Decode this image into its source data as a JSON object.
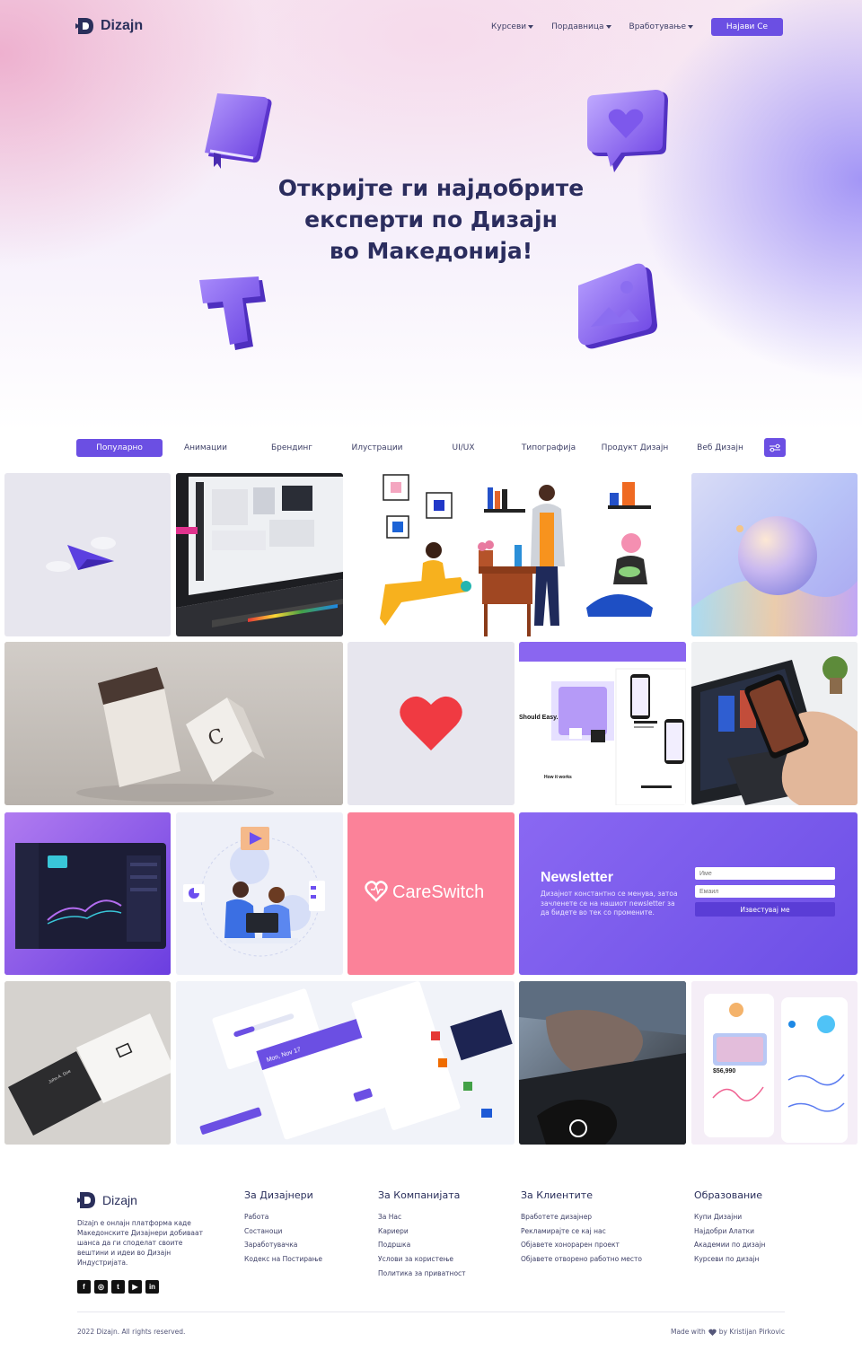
{
  "brand": {
    "name": "Dizajn"
  },
  "nav": {
    "links": [
      {
        "label": "Курсеви"
      },
      {
        "label": "Пордавница"
      },
      {
        "label": "Вработување"
      }
    ],
    "login_label": "Најави Се"
  },
  "hero": {
    "title_lines": [
      "Откријте ги најдобрите",
      "експерти по Дизајн",
      "во Македонија!"
    ]
  },
  "categories": {
    "active": "Популарно",
    "items": [
      "Популарно",
      "Анимации",
      "Брендинг",
      "Илустрации",
      "UI/UX",
      "Типографија",
      "Продукт Дизајн",
      "Веб Дизајн"
    ]
  },
  "tiles": {
    "careswitch_logo_text": "CareSwitch",
    "mock_texts": {
      "landing_heading": "Should Easy.",
      "how_it_works": "How it works",
      "date_label": "Mon, Nov 17",
      "card_name": "John A. Doe",
      "finance_value": "$56,990"
    }
  },
  "newsletter": {
    "title": "Newsletter",
    "text": "Дизајнот константно се менува, затоа зачленете се на нашиот newsletter за да бидете во тек со промените.",
    "name_placeholder": "Име",
    "email_placeholder": "Емаил",
    "button_label": "Известувај ме"
  },
  "footer": {
    "about": "Dizajn е онлајн платформа каде Македонските Дизајнери добиваат шанса да ги споделат своите вештини и идеи во Дизајн Индустријата.",
    "columns": [
      {
        "title": "За Дизајнери",
        "links": [
          "Работа",
          "Состаноци",
          "Заработувачка",
          "Кодекс на Постирање"
        ]
      },
      {
        "title": "За Компанијата",
        "links": [
          "За Нас",
          "Кариери",
          "Подршка",
          "Услови за користење",
          "Политика за приватност"
        ]
      },
      {
        "title": "За Клиентите",
        "links": [
          "Вработете дизајнер",
          "Рекламирајте се кај нас",
          "Објавете хонорарен проект",
          "Објавете отворено работно место"
        ]
      },
      {
        "title": "Образование",
        "links": [
          "Купи Дизајни",
          "Најдобри Алатки",
          "Академии по дизајн",
          "Курсеви по дизајн"
        ]
      }
    ],
    "social_icons": [
      "facebook-icon",
      "instagram-icon",
      "twitter-icon",
      "youtube-icon",
      "linkedin-icon"
    ],
    "copyright": "2022 Dizajn. All rights reserved.",
    "made_with_prefix": "Made with",
    "made_with_suffix": "by Kristijan Pirkovic"
  },
  "colors": {
    "accent": "#6b4fe3",
    "heading": "#2b2d5e",
    "careswitch_bg": "#fb8299",
    "newsletter_bg": "#7b5cf0"
  }
}
